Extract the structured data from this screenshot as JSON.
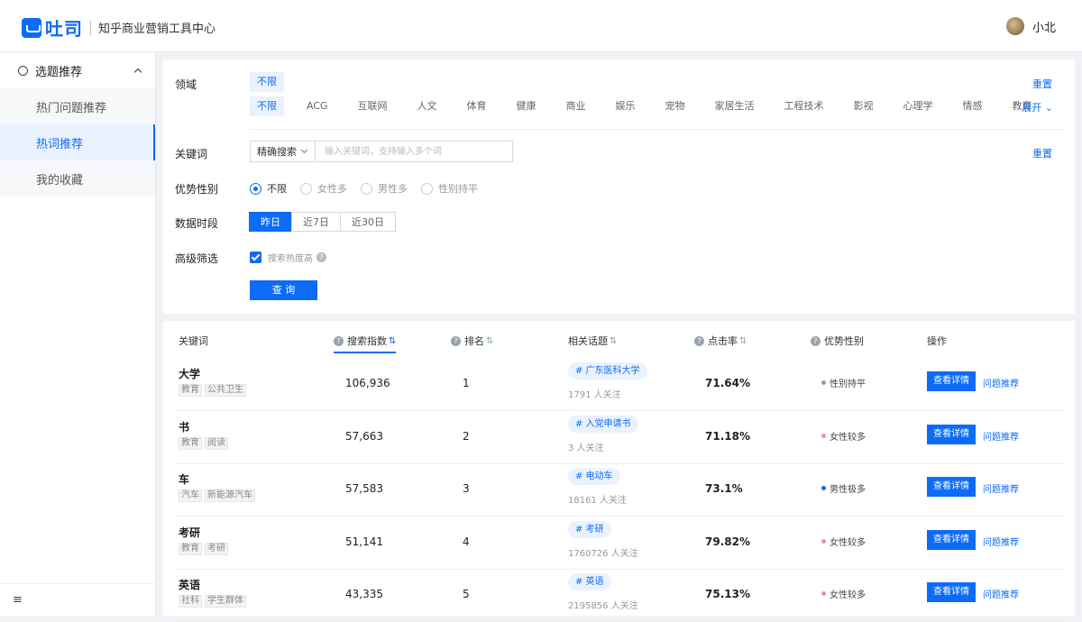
{
  "header": {
    "logo_text": "吐司",
    "subtitle": "知乎商业营销工具中心",
    "user_name": "小北"
  },
  "sidebar": {
    "group_label": "选题推荐",
    "items": [
      {
        "label": "热门问题推荐"
      },
      {
        "label": "热词推荐"
      },
      {
        "label": "我的收藏"
      }
    ],
    "collapse_icon": "≡"
  },
  "filter": {
    "domain_label": "领域",
    "domain_selected": "不限",
    "domains": [
      "不限",
      "ACG",
      "互联网",
      "人文",
      "体育",
      "健康",
      "商业",
      "娱乐",
      "宠物",
      "家居生活",
      "工程技术",
      "影视",
      "心理学",
      "情感",
      "教育"
    ],
    "reset": "重置",
    "expand": "展开",
    "keyword_label": "关键词",
    "keyword_mode": "精确搜索",
    "keyword_placeholder": "输入关键词，支持输入多个词",
    "gender_label": "优势性别",
    "gender_options": [
      "不限",
      "女性多",
      "男性多",
      "性别持平"
    ],
    "period_label": "数据时段",
    "periods": [
      "昨日",
      "近7日",
      "近30日"
    ],
    "advanced_label": "高级筛选",
    "advanced_option": "搜索热度高",
    "query_button": "查 询"
  },
  "table": {
    "headers": {
      "keyword": "关键词",
      "index": "搜索指数",
      "rank": "排名",
      "topic": "相关话题",
      "ctr": "点击率",
      "gender": "优势性别",
      "action": "操作"
    },
    "detail_label": "查看详情",
    "recommend_label": "问题推荐",
    "rows": [
      {
        "keyword": "大学",
        "tags": [
          "教育",
          "公共卫生"
        ],
        "index": "106,936",
        "rank": "1",
        "topic": "# 广东医科大学",
        "follow": "1791 人关注",
        "ctr": "71.64%",
        "gender": "性别持平",
        "gender_color": "#999999"
      },
      {
        "keyword": "书",
        "tags": [
          "教育",
          "阅读"
        ],
        "index": "57,663",
        "rank": "2",
        "topic": "# 入党申请书",
        "follow": "3 人关注",
        "ctr": "71.18%",
        "gender": "女性较多",
        "gender_color": "#f08ac8"
      },
      {
        "keyword": "车",
        "tags": [
          "汽车",
          "新能源汽车"
        ],
        "index": "57,583",
        "rank": "3",
        "topic": "# 电动车",
        "follow": "18161 人关注",
        "ctr": "73.1%",
        "gender": "男性极多",
        "gender_color": "#0c6cf6"
      },
      {
        "keyword": "考研",
        "tags": [
          "教育",
          "考研"
        ],
        "index": "51,141",
        "rank": "4",
        "topic": "# 考研",
        "follow": "1760726 人关注",
        "ctr": "79.82%",
        "gender": "女性较多",
        "gender_color": "#f08ac8"
      },
      {
        "keyword": "英语",
        "tags": [
          "社科",
          "学生群体"
        ],
        "index": "43,335",
        "rank": "5",
        "topic": "# 英语",
        "follow": "2195856 人关注",
        "ctr": "75.13%",
        "gender": "女性较多",
        "gender_color": "#f08ac8"
      }
    ]
  }
}
